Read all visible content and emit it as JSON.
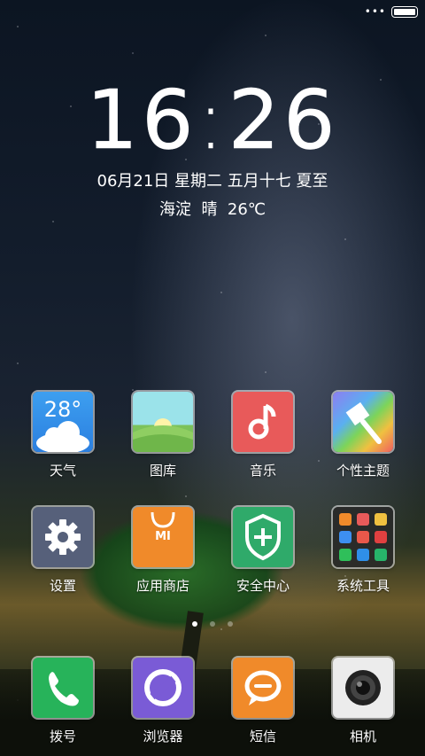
{
  "status_bar": {
    "signal_dots": "•••"
  },
  "lockclock": {
    "time_hour": "16",
    "time_minute": "26",
    "date": "06月21日 星期二 五月十七 夏至",
    "location": "海淀",
    "condition": "晴",
    "temperature": "26℃"
  },
  "apps": [
    {
      "label": "天气",
      "icon": "weather-icon",
      "icon_text": "28°",
      "color": "#2f8fe8"
    },
    {
      "label": "图库",
      "icon": "gallery-icon",
      "color": "#8fdfe6"
    },
    {
      "label": "音乐",
      "icon": "music-icon",
      "color": "#e85555"
    },
    {
      "label": "个性主题",
      "icon": "themes-icon",
      "color": "#b9a6e8"
    },
    {
      "label": "设置",
      "icon": "settings-icon",
      "color": "#56607a"
    },
    {
      "label": "应用商店",
      "icon": "app-store-icon",
      "icon_text": "MI",
      "color": "#f08a2a"
    },
    {
      "label": "安全中心",
      "icon": "security-icon",
      "color": "#2faa6a"
    },
    {
      "label": "系统工具",
      "icon": "tools-folder-icon",
      "color": "#2c2c2c"
    }
  ],
  "pager": {
    "pages": 3,
    "active": 1
  },
  "dock": [
    {
      "label": "拨号",
      "icon": "phone-icon",
      "color": "#27b35a"
    },
    {
      "label": "浏览器",
      "icon": "browser-icon",
      "color": "#7a5bd6"
    },
    {
      "label": "短信",
      "icon": "message-icon",
      "color": "#f08a2a"
    },
    {
      "label": "相机",
      "icon": "camera-icon",
      "color": "#e8e8e8"
    }
  ]
}
